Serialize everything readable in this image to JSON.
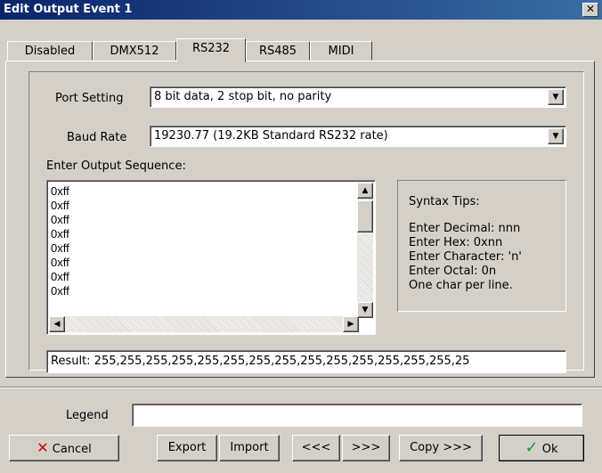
{
  "window": {
    "title": "Edit Output Event 1",
    "close_label": "✕"
  },
  "tabs": [
    {
      "label": "Disabled",
      "active": false
    },
    {
      "label": "DMX512",
      "active": false
    },
    {
      "label": "RS232",
      "active": true
    },
    {
      "label": "RS485",
      "active": false
    },
    {
      "label": "MIDI",
      "active": false
    }
  ],
  "form": {
    "port_setting_label": "Port Setting",
    "port_setting_value": "8 bit data, 2 stop bit, no parity",
    "baud_rate_label": "Baud Rate",
    "baud_rate_value": "19230.77 (19.2KB Standard RS232 rate)",
    "sequence_label": "Enter Output Sequence:",
    "sequence_lines": [
      "0xff",
      "0xff",
      "0xff",
      "0xff",
      "0xff",
      "0xff",
      "0xff",
      "0xff"
    ],
    "result_text": "Result: 255,255,255,255,255,255,255,255,255,255,255,255,255,255,25"
  },
  "syntax_tips": {
    "title": "Syntax Tips:",
    "lines": [
      "Enter Decimal: nnn",
      "Enter Hex: 0xnn",
      "Enter Character: 'n'",
      "Enter Octal: 0n",
      "One char per line."
    ]
  },
  "footer": {
    "legend_label": "Legend",
    "legend_value": "",
    "cancel_label": "Cancel",
    "export_label": "Export",
    "import_label": "Import",
    "prev_label": "<<<",
    "next_label": ">>>",
    "copy_label": "Copy >>>",
    "ok_label": "Ok"
  },
  "colors": {
    "title_start": "#0a246a",
    "title_end": "#3a6ea5",
    "face": "#d4d0c8",
    "cancel_icon": "#cc0000",
    "ok_icon": "#2e8b2e"
  },
  "icons": {
    "dropdown": "▼",
    "up": "▲",
    "down": "▼",
    "left": "◀",
    "right": "▶",
    "cancel": "✕",
    "ok": "✓"
  }
}
